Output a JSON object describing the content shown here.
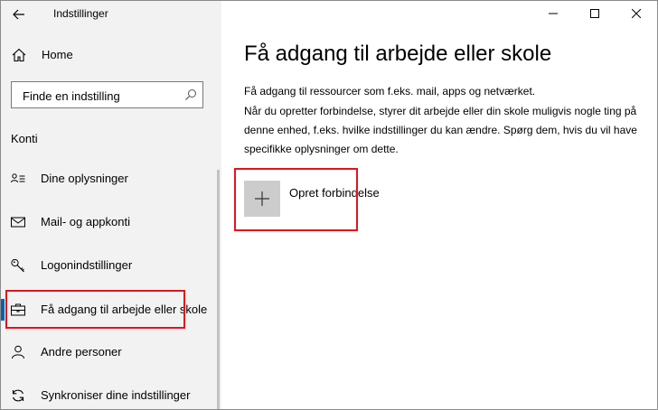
{
  "window": {
    "title": "Indstillinger",
    "controls": [
      "minimize-icon",
      "maximize-icon",
      "close-icon"
    ]
  },
  "sidebar": {
    "home_label": "Home",
    "search": {
      "placeholder": "Finde en indstilling"
    },
    "section_header": "Konti",
    "items": [
      {
        "label": "Dine oplysninger",
        "icon": "person-card-icon"
      },
      {
        "label": "Mail- og appkonti",
        "icon": "mail-icon"
      },
      {
        "label": "Logonindstillinger",
        "icon": "key-icon"
      },
      {
        "label": "Få adgang til arbejde eller skole",
        "icon": "briefcase-icon",
        "selected": true
      },
      {
        "label": "Andre personer",
        "icon": "person-icon"
      },
      {
        "label": "Synkroniser dine indstillinger",
        "icon": "sync-icon"
      }
    ]
  },
  "main": {
    "title": "Få adgang til arbejde eller skole",
    "description_line1": "Få adgang til ressourcer som f.eks. mail, apps og netværket.",
    "description_line2": "Når du opretter forbindelse, styrer dit arbejde eller din skole muligvis nogle ting på denne enhed, f.eks. hvilke indstillinger du kan ændre. Spørg dem, hvis du vil have specifikke oplysninger om dette.",
    "connect_label": "Opret forbindelse"
  },
  "colors": {
    "sidebar_bg": "#f2f2f2",
    "accent": "#0063b1",
    "highlight_box": "#e0151b",
    "tile_bg": "#cccccc"
  }
}
